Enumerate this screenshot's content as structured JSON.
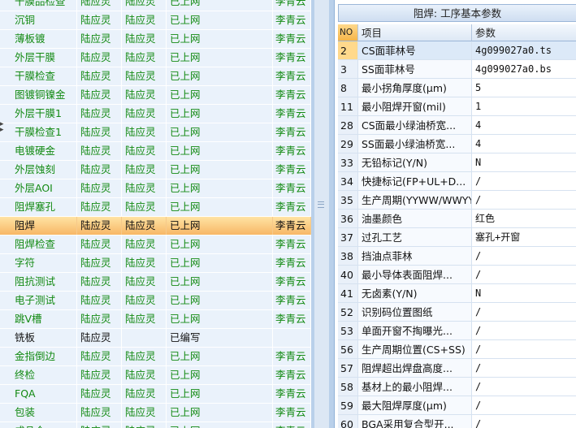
{
  "process_list": {
    "rows": [
      {
        "name": "干膜品检查",
        "c1": "陆应灵",
        "c2": "陆应灵",
        "status": "已上网",
        "user": "李青云",
        "style": "green"
      },
      {
        "name": "沉铜",
        "c1": "陆应灵",
        "c2": "陆应灵",
        "status": "已上网",
        "user": "李青云",
        "style": "green"
      },
      {
        "name": "薄板镀",
        "c1": "陆应灵",
        "c2": "陆应灵",
        "status": "已上网",
        "user": "李青云",
        "style": "green"
      },
      {
        "name": "外层干膜",
        "c1": "陆应灵",
        "c2": "陆应灵",
        "status": "已上网",
        "user": "李青云",
        "style": "green"
      },
      {
        "name": "干膜检查",
        "c1": "陆应灵",
        "c2": "陆应灵",
        "status": "已上网",
        "user": "李青云",
        "style": "green"
      },
      {
        "name": "图镀铜镍金",
        "c1": "陆应灵",
        "c2": "陆应灵",
        "status": "已上网",
        "user": "李青云",
        "style": "green"
      },
      {
        "name": "外层干膜1",
        "c1": "陆应灵",
        "c2": "陆应灵",
        "status": "已上网",
        "user": "李青云",
        "style": "green"
      },
      {
        "name": "干膜检查1",
        "c1": "陆应灵",
        "c2": "陆应灵",
        "status": "已上网",
        "user": "李青云",
        "style": "green"
      },
      {
        "name": "电镀硬金",
        "c1": "陆应灵",
        "c2": "陆应灵",
        "status": "已上网",
        "user": "李青云",
        "style": "green"
      },
      {
        "name": "外层蚀刻",
        "c1": "陆应灵",
        "c2": "陆应灵",
        "status": "已上网",
        "user": "李青云",
        "style": "green"
      },
      {
        "name": "外层AOI",
        "c1": "陆应灵",
        "c2": "陆应灵",
        "status": "已上网",
        "user": "李青云",
        "style": "green"
      },
      {
        "name": "阻焊塞孔",
        "c1": "陆应灵",
        "c2": "陆应灵",
        "status": "已上网",
        "user": "李青云",
        "style": "green"
      },
      {
        "name": "阻焊",
        "c1": "陆应灵",
        "c2": "陆应灵",
        "status": "已上网",
        "user": "李青云",
        "style": "selected"
      },
      {
        "name": "阻焊检查",
        "c1": "陆应灵",
        "c2": "陆应灵",
        "status": "已上网",
        "user": "李青云",
        "style": "green"
      },
      {
        "name": "字符",
        "c1": "陆应灵",
        "c2": "陆应灵",
        "status": "已上网",
        "user": "李青云",
        "style": "green"
      },
      {
        "name": "阻抗测试",
        "c1": "陆应灵",
        "c2": "陆应灵",
        "status": "已上网",
        "user": "李青云",
        "style": "green"
      },
      {
        "name": "电子测试",
        "c1": "陆应灵",
        "c2": "陆应灵",
        "status": "已上网",
        "user": "李青云",
        "style": "green"
      },
      {
        "name": "跳V槽",
        "c1": "陆应灵",
        "c2": "陆应灵",
        "status": "已上网",
        "user": "李青云",
        "style": "green"
      },
      {
        "name": "铣板",
        "c1": "陆应灵",
        "c2": "",
        "status": "已编写",
        "user": "",
        "style": "black"
      },
      {
        "name": "金指倒边",
        "c1": "陆应灵",
        "c2": "陆应灵",
        "status": "已上网",
        "user": "李青云",
        "style": "green"
      },
      {
        "name": "终检",
        "c1": "陆应灵",
        "c2": "陆应灵",
        "status": "已上网",
        "user": "李青云",
        "style": "green"
      },
      {
        "name": "FQA",
        "c1": "陆应灵",
        "c2": "陆应灵",
        "status": "已上网",
        "user": "李青云",
        "style": "green"
      },
      {
        "name": "包装",
        "c1": "陆应灵",
        "c2": "陆应灵",
        "status": "已上网",
        "user": "李青云",
        "style": "green"
      },
      {
        "name": "成品仓",
        "c1": "陆应灵",
        "c2": "陆应灵",
        "status": "已上网",
        "user": "李青云",
        "style": "green"
      }
    ]
  },
  "param_panel": {
    "title": "阻焊: 工序基本参数",
    "headers": [
      "NO",
      "项目",
      "参数"
    ],
    "rows": [
      {
        "no": "2",
        "item": "CS面菲林号",
        "value": "4g099027a0.ts"
      },
      {
        "no": "3",
        "item": "SS面菲林号",
        "value": "4g099027a0.bs"
      },
      {
        "no": "8",
        "item": "最小拐角厚度(μm)",
        "value": "5"
      },
      {
        "no": "11",
        "item": "最小阻焊开窗(mil)",
        "value": "1"
      },
      {
        "no": "28",
        "item": "CS面最小绿油桥宽...",
        "value": "4"
      },
      {
        "no": "29",
        "item": "SS面最小绿油桥宽...",
        "value": "4"
      },
      {
        "no": "33",
        "item": "无铅标记(Y/N)",
        "value": "N"
      },
      {
        "no": "34",
        "item": "快捷标记(FP+UL+D...",
        "value": "/"
      },
      {
        "no": "35",
        "item": "生产周期(YYWW/WWYY)",
        "value": "/"
      },
      {
        "no": "36",
        "item": "油墨颜色",
        "value": "红色"
      },
      {
        "no": "37",
        "item": "过孔工艺",
        "value": "塞孔+开窗"
      },
      {
        "no": "38",
        "item": "挡油点菲林",
        "value": "/"
      },
      {
        "no": "40",
        "item": "最小导体表面阻焊...",
        "value": "/"
      },
      {
        "no": "41",
        "item": "无卤素(Y/N)",
        "value": "N"
      },
      {
        "no": "52",
        "item": "识别码位置图纸",
        "value": "/"
      },
      {
        "no": "53",
        "item": "单面开窗不掏曝光...",
        "value": "/"
      },
      {
        "no": "56",
        "item": "生产周期位置(CS+SS)",
        "value": "/"
      },
      {
        "no": "57",
        "item": "阻焊超出焊盘高度...",
        "value": "/"
      },
      {
        "no": "58",
        "item": "基材上的最小阻焊...",
        "value": "/"
      },
      {
        "no": "59",
        "item": "最大阻焊厚度(μm)",
        "value": "/"
      },
      {
        "no": "60",
        "item": "BGA采用复合型开...",
        "value": "/"
      }
    ]
  },
  "icons": {
    "splitter": "splitter-grip-icon",
    "row_pointer": "row-pointer-icon"
  }
}
